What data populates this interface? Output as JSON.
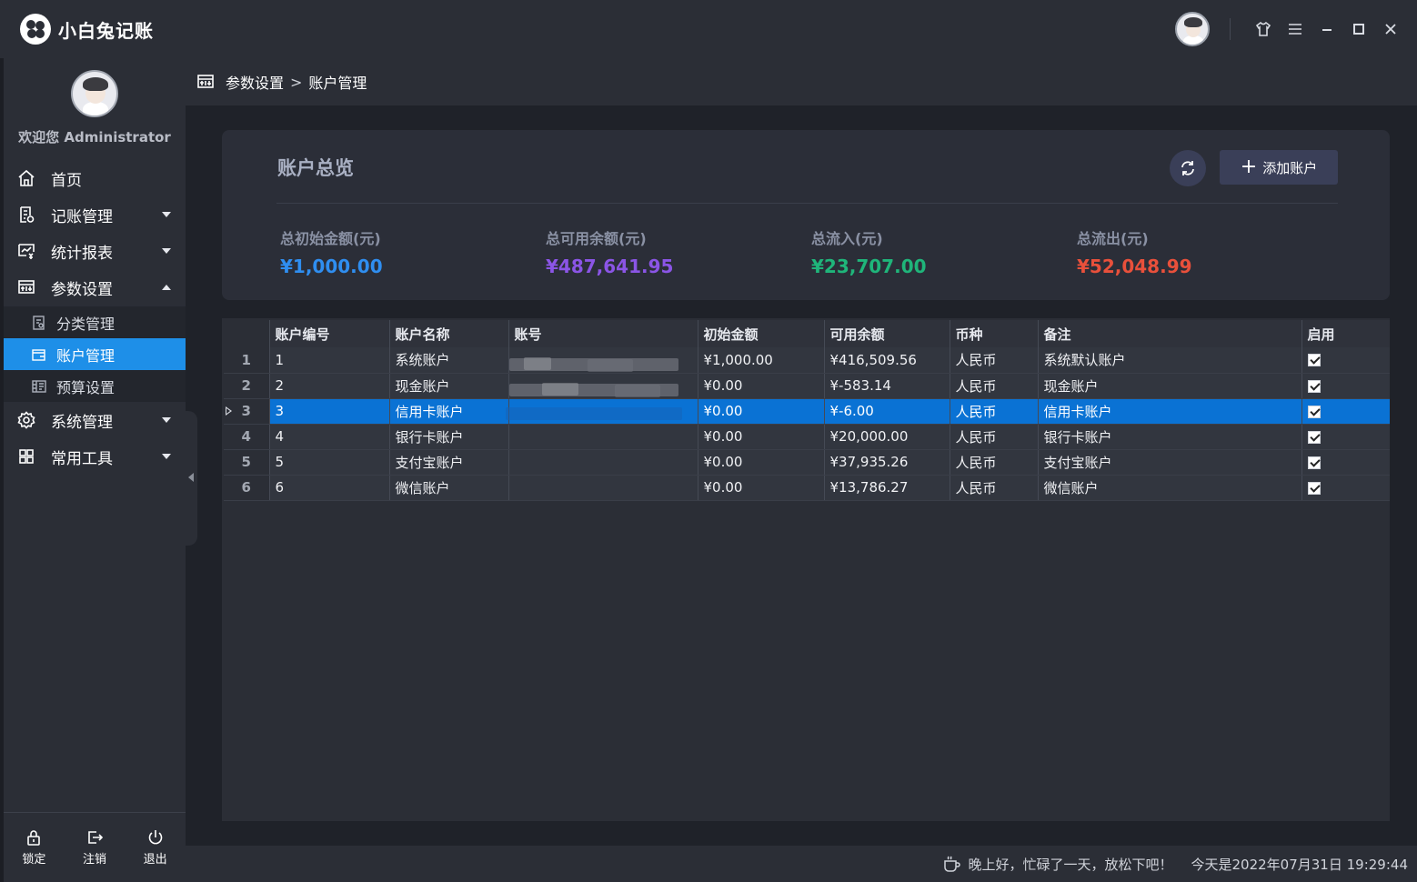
{
  "app": {
    "title": "小白兔记账"
  },
  "titlebar": {
    "buttons": [
      "skin-icon",
      "menu-icon",
      "minimize-icon",
      "maximize-icon",
      "close-icon"
    ]
  },
  "sidebar": {
    "welcome": "欢迎您 Administrator",
    "items": [
      {
        "label": "首页",
        "icon": "home-icon"
      },
      {
        "label": "记账管理",
        "icon": "ledger-icon"
      },
      {
        "label": "统计报表",
        "icon": "chart-icon"
      },
      {
        "label": "参数设置",
        "icon": "settings-panel-icon"
      },
      {
        "label": "系统管理",
        "icon": "gear-icon"
      },
      {
        "label": "常用工具",
        "icon": "grid-icon"
      }
    ],
    "subitems": [
      {
        "label": "分类管理",
        "icon": "category-icon"
      },
      {
        "label": "账户管理",
        "icon": "account-icon"
      },
      {
        "label": "预算设置",
        "icon": "budget-icon"
      }
    ],
    "bottom": [
      {
        "label": "锁定",
        "icon": "lock-icon"
      },
      {
        "label": "注销",
        "icon": "logout-icon"
      },
      {
        "label": "退出",
        "icon": "power-icon"
      }
    ]
  },
  "breadcrumb": {
    "parent": "参数设置",
    "separator": ">",
    "current": "账户管理"
  },
  "overview": {
    "title": "账户总览",
    "add_label": "添加账户",
    "stats": [
      {
        "label": "总初始金额(元)",
        "value": "¥1,000.00",
        "color": "#2f8ef0"
      },
      {
        "label": "总可用余额(元)",
        "value": "¥487,641.95",
        "color": "#8b55e6"
      },
      {
        "label": "总流入(元)",
        "value": "¥23,707.00",
        "color": "#1fb57a"
      },
      {
        "label": "总流出(元)",
        "value": "¥52,048.99",
        "color": "#e9503b"
      }
    ]
  },
  "table": {
    "columns": [
      "账户编号",
      "账户名称",
      "账号",
      "初始金额",
      "可用余额",
      "币种",
      "备注",
      "启用"
    ],
    "selected_row": 3,
    "rows": [
      {
        "no": "1",
        "id": "1",
        "name": "系统账户",
        "account": "",
        "initial": "¥1,000.00",
        "balance": "¥416,509.56",
        "currency": "人民币",
        "note": "系统默认账户",
        "enabled": true
      },
      {
        "no": "2",
        "id": "2",
        "name": "现金账户",
        "account": "",
        "initial": "¥0.00",
        "balance": "¥-583.14",
        "currency": "人民币",
        "note": "现金账户",
        "enabled": true
      },
      {
        "no": "3",
        "id": "3",
        "name": "信用卡账户",
        "account": "",
        "initial": "¥0.00",
        "balance": "¥-6.00",
        "currency": "人民币",
        "note": "信用卡账户",
        "enabled": true
      },
      {
        "no": "4",
        "id": "4",
        "name": "银行卡账户",
        "account": "",
        "initial": "¥0.00",
        "balance": "¥20,000.00",
        "currency": "人民币",
        "note": "银行卡账户",
        "enabled": true
      },
      {
        "no": "5",
        "id": "5",
        "name": "支付宝账户",
        "account": "",
        "initial": "¥0.00",
        "balance": "¥37,935.26",
        "currency": "人民币",
        "note": "支付宝账户",
        "enabled": true
      },
      {
        "no": "6",
        "id": "6",
        "name": "微信账户",
        "account": "",
        "initial": "¥0.00",
        "balance": "¥13,786.27",
        "currency": "人民币",
        "note": "微信账户",
        "enabled": true
      }
    ]
  },
  "statusbar": {
    "message": "晚上好，忙碌了一天，放松下吧！",
    "date": "今天是2022年07月31日 19:29:44"
  }
}
